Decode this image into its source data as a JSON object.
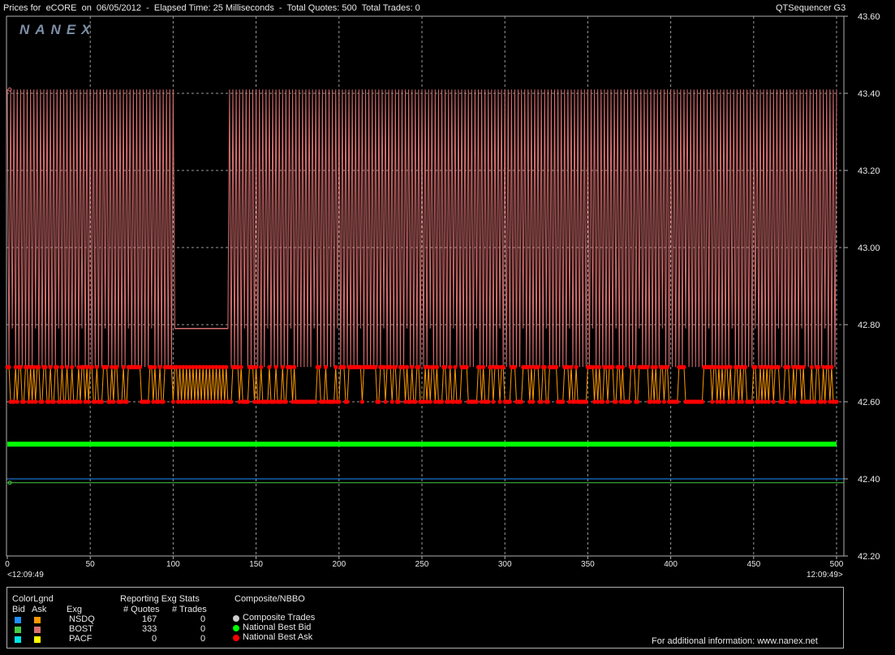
{
  "header": {
    "title": "Prices for  eCORE  on  06/05/2012  -  Elapsed Time: 25 Milliseconds  -  Total Quotes: 500  Total Trades: 0",
    "app": "QTSequencer G3"
  },
  "watermark": "NANEX",
  "time_start": "<12:09:49",
  "time_end": "12:09:49>",
  "legend": {
    "colorlgnd_title": "ColorLgnd",
    "bid_label": "Bid",
    "ask_label": "Ask",
    "exg_label": "Exg",
    "stats_title": "Reporting Exg Stats",
    "quotes_label": "# Quotes",
    "trades_label": "# Trades",
    "composite_title": "Composite/NBBO",
    "exchanges": [
      {
        "name": "NSDQ",
        "quotes": "167",
        "trades": "0",
        "bid_color": "#1e90ff",
        "ask_color": "#ff9900"
      },
      {
        "name": "BOST",
        "quotes": "333",
        "trades": "0",
        "bid_color": "#44cc44",
        "ask_color": "#d97070"
      },
      {
        "name": "PACF",
        "quotes": "0",
        "trades": "0",
        "bid_color": "#00e5e5",
        "ask_color": "#ffff00"
      }
    ],
    "composite": [
      {
        "label": "Composite Trades",
        "color": "#cccccc"
      },
      {
        "label": "National Best Bid",
        "color": "#00ff00"
      },
      {
        "label": "National Best Ask",
        "color": "#ff0000"
      }
    ],
    "footer": "For additional information: www.nanex.net"
  },
  "chart_data": {
    "type": "line",
    "title": "Prices for  eCORE  on  06/05/2012",
    "xlabel": "",
    "ylabel": "",
    "xlim": [
      0,
      500
    ],
    "ylim": [
      42.2,
      43.6
    ],
    "x_ticks": [
      "0",
      "50",
      "100",
      "150",
      "200",
      "250",
      "300",
      "350",
      "400",
      "450",
      "500"
    ],
    "y_ticks": [
      "42.20",
      "42.40",
      "42.60",
      "42.80",
      "43.00",
      "43.20",
      "43.40",
      "43.60"
    ],
    "grid": true,
    "y_axis_side": "right",
    "levels": {
      "bost_ask_high": 43.41,
      "nsdq_ask_high": 42.69,
      "nbo_high": 42.69,
      "nbo_low": 42.6,
      "national_best_bid": 42.49,
      "nsdq_bid": 42.4,
      "bost_bid": 42.39,
      "bost_ask_flat_segment": 42.79
    },
    "series": [
      {
        "name": "BOST",
        "color": "#d97070"
      },
      {
        "name": "NSDQ",
        "color": "#ff9900"
      },
      {
        "name": "National Best Bid",
        "color": "#00ff00"
      },
      {
        "name": "National Best Ask",
        "color": "#ff0000"
      }
    ]
  }
}
